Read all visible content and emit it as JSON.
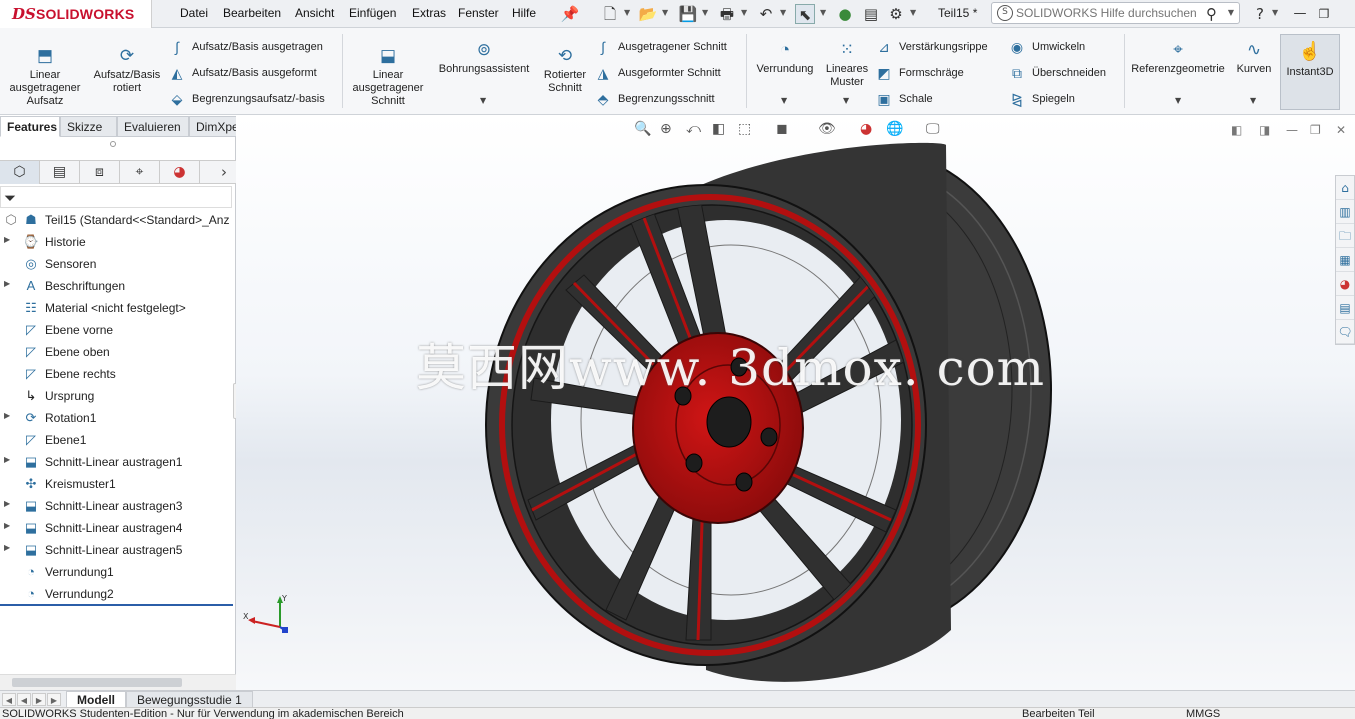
{
  "app": {
    "brand_mark": "DS",
    "brand_name": "SOLIDWORKS",
    "doc_title": "Teil15 *"
  },
  "menu": [
    "Datei",
    "Bearbeiten",
    "Ansicht",
    "Einfügen",
    "Extras",
    "Fenster",
    "Hilfe"
  ],
  "search": {
    "placeholder": "SOLIDWORKS Hilfe durchsuchen"
  },
  "ribbon": {
    "extrude_boss": "Linear ausgetragener Aufsatz",
    "revolve_boss": "Aufsatz/Basis rotiert",
    "swept_boss": "Aufsatz/Basis ausgetragen",
    "lofted_boss": "Aufsatz/Basis ausgeformt",
    "boundary_boss": "Begrenzungsaufsatz/-basis",
    "extrude_cut": "Linear ausgetragener Schnitt",
    "hole_wizard": "Bohrungsassistent",
    "revolve_cut": "Rotierter Schnitt",
    "swept_cut": "Ausgetragener Schnitt",
    "lofted_cut": "Ausgeformter Schnitt",
    "boundary_cut": "Begrenzungsschnitt",
    "fillet": "Verrundung",
    "linear_pattern": "Lineares Muster",
    "rib": "Verstärkungsrippe",
    "draft": "Formschräge",
    "shell": "Schale",
    "wrap": "Umwickeln",
    "intersect": "Überschneiden",
    "mirror": "Spiegeln",
    "ref_geometry": "Referenzgeometrie",
    "curves": "Kurven",
    "instant3d": "Instant3D"
  },
  "cm_tabs": [
    "Features",
    "Skizze",
    "Evaluieren",
    "DimXpert"
  ],
  "tree": {
    "root": "Teil15  (Standard<<Standard>_Anz",
    "items": [
      "Historie",
      "Sensoren",
      "Beschriftungen",
      "Material <nicht festgelegt>",
      "Ebene vorne",
      "Ebene oben",
      "Ebene rechts",
      "Ursprung",
      "Rotation1",
      "Ebene1",
      "Schnitt-Linear austragen1",
      "Kreismuster1",
      "Schnitt-Linear austragen3",
      "Schnitt-Linear austragen4",
      "Schnitt-Linear austragen5",
      "Verrundung1",
      "Verrundung2"
    ]
  },
  "viewport": {
    "watermark": "莫西网www. 3dmox. com",
    "triad": {
      "x": "X",
      "y": "Y"
    }
  },
  "bottom_tabs": [
    "Modell",
    "Bewegungsstudie 1"
  ],
  "status": {
    "left": "SOLIDWORKS Studenten-Edition - Nur für Verwendung im akademischen Bereich",
    "mode": "Bearbeiten Teil",
    "units": "MMGS"
  },
  "colors": {
    "brand": "#c8102e",
    "rim_red": "#b30f0f",
    "tire": "#3a3a3a",
    "accent": "#2e6f9e"
  }
}
